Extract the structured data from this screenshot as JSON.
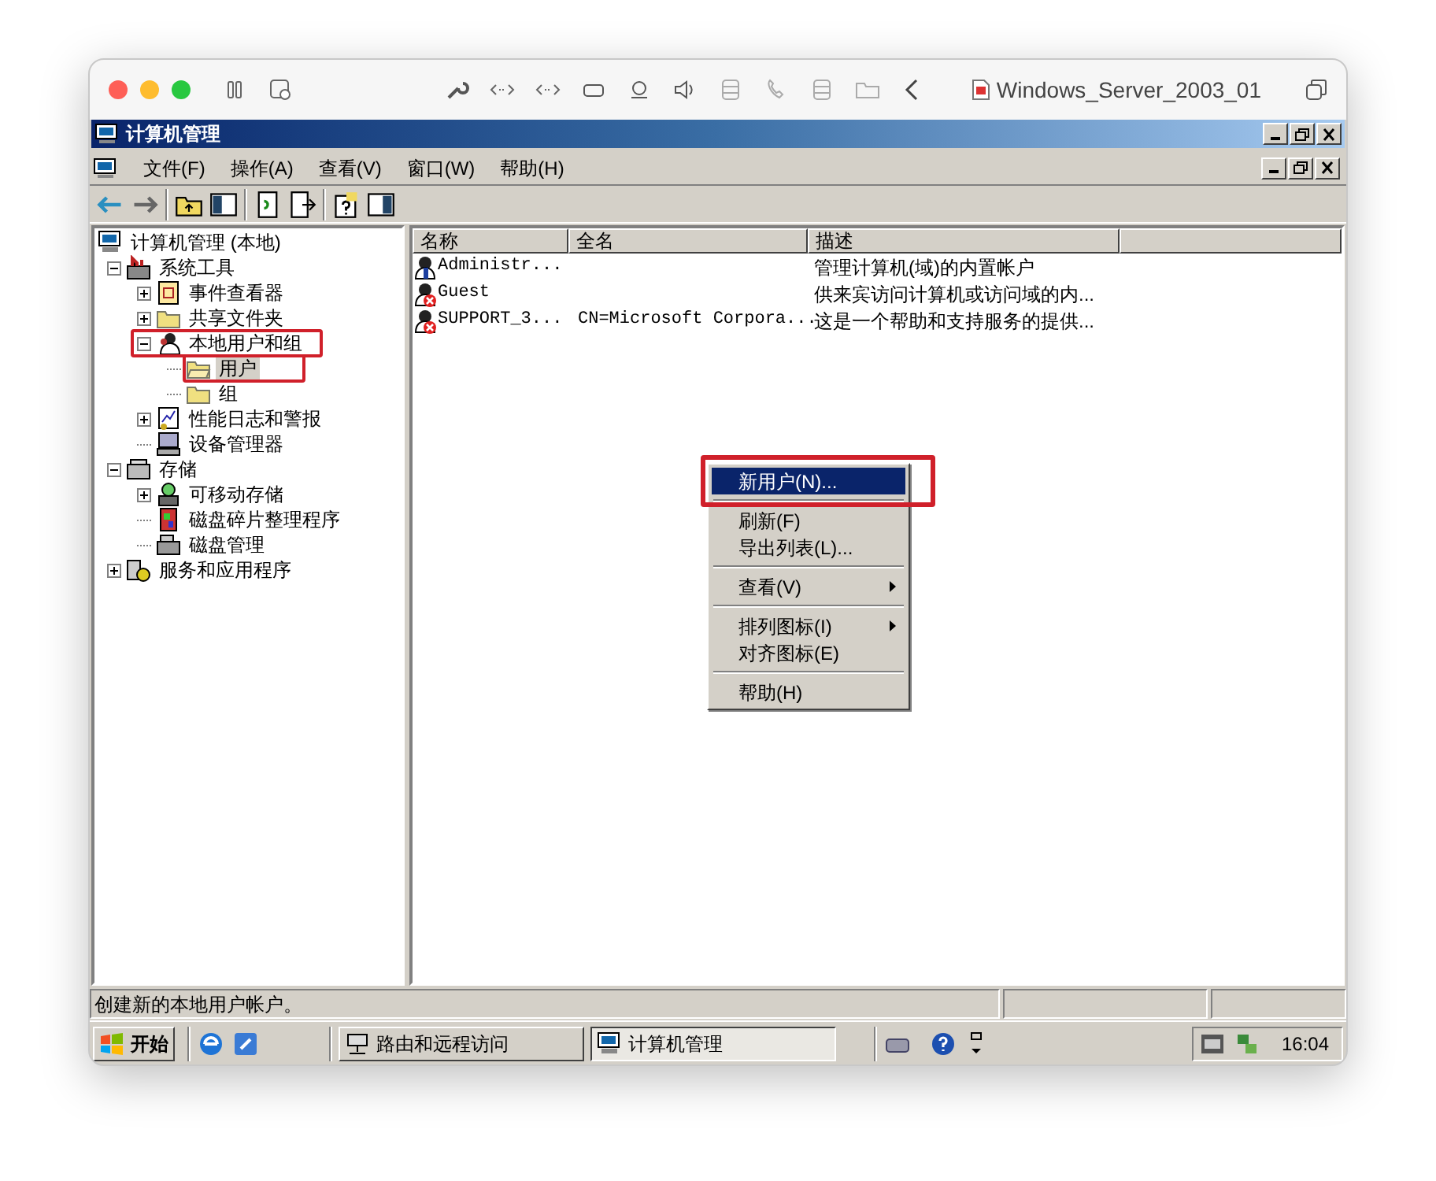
{
  "host_window": {
    "title": "Windows_Server_2003_01"
  },
  "window": {
    "title": "计算机管理"
  },
  "menu_bar": [
    "文件(F)",
    "操作(A)",
    "查看(V)",
    "窗口(W)",
    "帮助(H)"
  ],
  "tree": [
    {
      "label": "计算机管理 (本地)",
      "selected": false,
      "children": [
        {
          "label": "系统工具",
          "expanded": true,
          "selected": false,
          "children": [
            {
              "label": "事件查看器",
              "expanded": false,
              "selected": false
            },
            {
              "label": "共享文件夹",
              "expanded": false,
              "selected": false
            },
            {
              "label": "本地用户和组",
              "expanded": true,
              "selected": false,
              "highlighted": true,
              "children": [
                {
                  "label": "用户",
                  "selected": true,
                  "highlighted": true
                },
                {
                  "label": "组",
                  "selected": false
                }
              ]
            },
            {
              "label": "性能日志和警报",
              "expanded": false,
              "selected": false
            },
            {
              "label": "设备管理器",
              "selected": false
            }
          ]
        },
        {
          "label": "存储",
          "expanded": true,
          "selected": false,
          "children": [
            {
              "label": "可移动存储",
              "expanded": false,
              "selected": false
            },
            {
              "label": "磁盘碎片整理程序",
              "selected": false
            },
            {
              "label": "磁盘管理",
              "selected": false
            }
          ]
        },
        {
          "label": "服务和应用程序",
          "expanded": false,
          "selected": false
        }
      ]
    }
  ],
  "list": {
    "columns": [
      "名称",
      "全名",
      "描述"
    ],
    "rows": [
      {
        "name": "Administr...",
        "description": "管理计算机(域)的内置帐户",
        "disabled": false
      },
      {
        "name": "Guest",
        "description": "供来宾访问计算机或访问域的内...",
        "disabled": true
      },
      {
        "name": "SUPPORT_3...",
        "full_name": "CN=Microsoft Corpora...",
        "description": "这是一个帮助和支持服务的提供...",
        "disabled": true
      }
    ]
  },
  "context_menu": [
    {
      "kind": "item",
      "label": "新用户(N)...",
      "selected": true,
      "highlighted": true
    },
    {
      "kind": "separator"
    },
    {
      "kind": "item",
      "label": "刷新(F)",
      "selected": false
    },
    {
      "kind": "item",
      "label": "导出列表(L)...",
      "selected": false
    },
    {
      "kind": "separator"
    },
    {
      "kind": "item",
      "label": "查看(V)",
      "selected": false,
      "submenu": true
    },
    {
      "kind": "separator"
    },
    {
      "kind": "item",
      "label": "排列图标(I)",
      "selected": false,
      "submenu": true
    },
    {
      "kind": "item",
      "label": "对齐图标(E)",
      "selected": false
    },
    {
      "kind": "separator"
    },
    {
      "kind": "item",
      "label": "帮助(H)",
      "selected": false
    }
  ],
  "status_bar": {
    "message": "创建新的本地用户帐户。"
  },
  "taskbar": {
    "start": "开始",
    "tasks": [
      {
        "label": "路由和远程访问",
        "selected": false
      },
      {
        "label": "计算机管理",
        "selected": true
      }
    ],
    "clock": "16:04"
  }
}
